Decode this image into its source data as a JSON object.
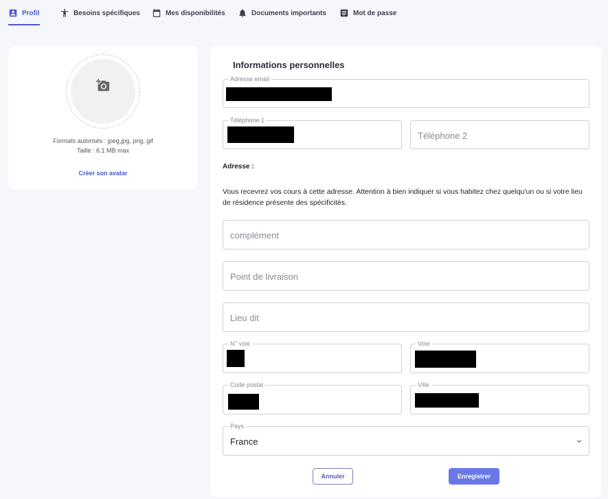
{
  "tabs": [
    {
      "label": "Profil",
      "icon": "account-box-icon",
      "active": true
    },
    {
      "label": "Besoins spécifiques",
      "icon": "accessibility-icon",
      "active": false
    },
    {
      "label": "Mes disponibilités",
      "icon": "calendar-icon",
      "active": false
    },
    {
      "label": "Documents importants",
      "icon": "bell-icon",
      "active": false
    },
    {
      "label": "Mot de passe",
      "icon": "document-icon",
      "active": false
    }
  ],
  "avatar": {
    "icon": "add-photo-icon",
    "formats": "Formats autorisés : jpeg,jpg, png, gif",
    "size": "Taille : 6.1 MB max",
    "create_link": "Créer son avatar"
  },
  "form": {
    "title": "Informations personnelles",
    "email_label": "Adresse email",
    "phone1_label": "Téléphone 1",
    "phone2_placeholder": "Téléphone 2",
    "address_heading": "Adresse :",
    "address_description": "Vous recevrez vos cours à cette adresse. Attention à bien indiquer si vous habitez chez quelqu'un ou si votre lieu de résidence présente des spécificités.",
    "complement_placeholder": "complément",
    "delivery_placeholder": "Point de livraison",
    "lieudit_placeholder": "Lieu dit",
    "street_number_label": "N° voie",
    "street_label": "Voie",
    "postal_code_label": "Code postal",
    "city_label": "Ville",
    "country_label": "Pays",
    "country_value": "France",
    "cancel_label": "Annuler",
    "save_label": "Enregistrer"
  },
  "colors": {
    "accent": "#4a58c9",
    "save_button": "#6a78e8",
    "background": "#f6f7fb"
  }
}
